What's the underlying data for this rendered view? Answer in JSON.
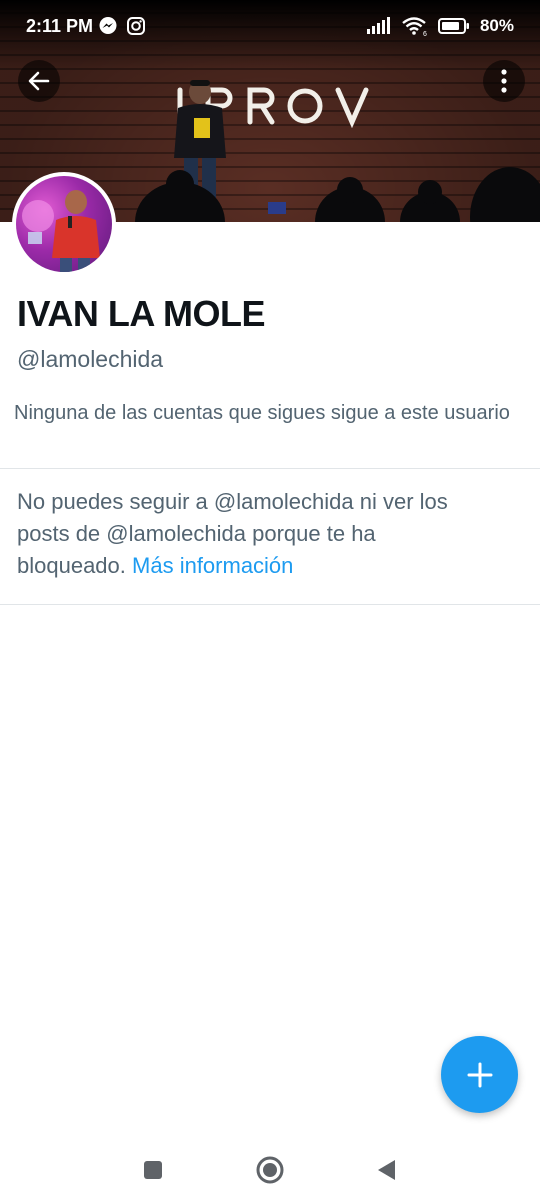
{
  "status_bar": {
    "time": "2:11 PM",
    "app_icons": [
      "messenger-icon",
      "instagram-icon"
    ],
    "signal_icon": "signal-icon",
    "wifi_icon": "wifi-icon",
    "battery_icon": "battery-icon",
    "battery_percent": "80%"
  },
  "header": {
    "back_icon": "arrow-left-icon",
    "more_icon": "more-vertical-icon",
    "banner_sign_text": "IMPROV"
  },
  "profile": {
    "name": "IVAN LA MOLE",
    "handle": "@lamolechida",
    "follow_note": "Ninguna de las cuentas que sigues sigue a este usuario",
    "blocked_message": "No puedes seguir a @lamolechida ni ver los posts de @lamolechida porque te ha bloqueado.",
    "blocked_link": "Más información"
  },
  "fab": {
    "icon": "plus-icon"
  },
  "nav_bar": {
    "recents_icon": "square-icon",
    "home_icon": "circle-home-icon",
    "back_icon": "triangle-back-icon"
  },
  "colors": {
    "accent": "#1d9bf0",
    "name_text": "#0f1419",
    "secondary_text": "#536471",
    "divider": "#e1e5e8"
  }
}
